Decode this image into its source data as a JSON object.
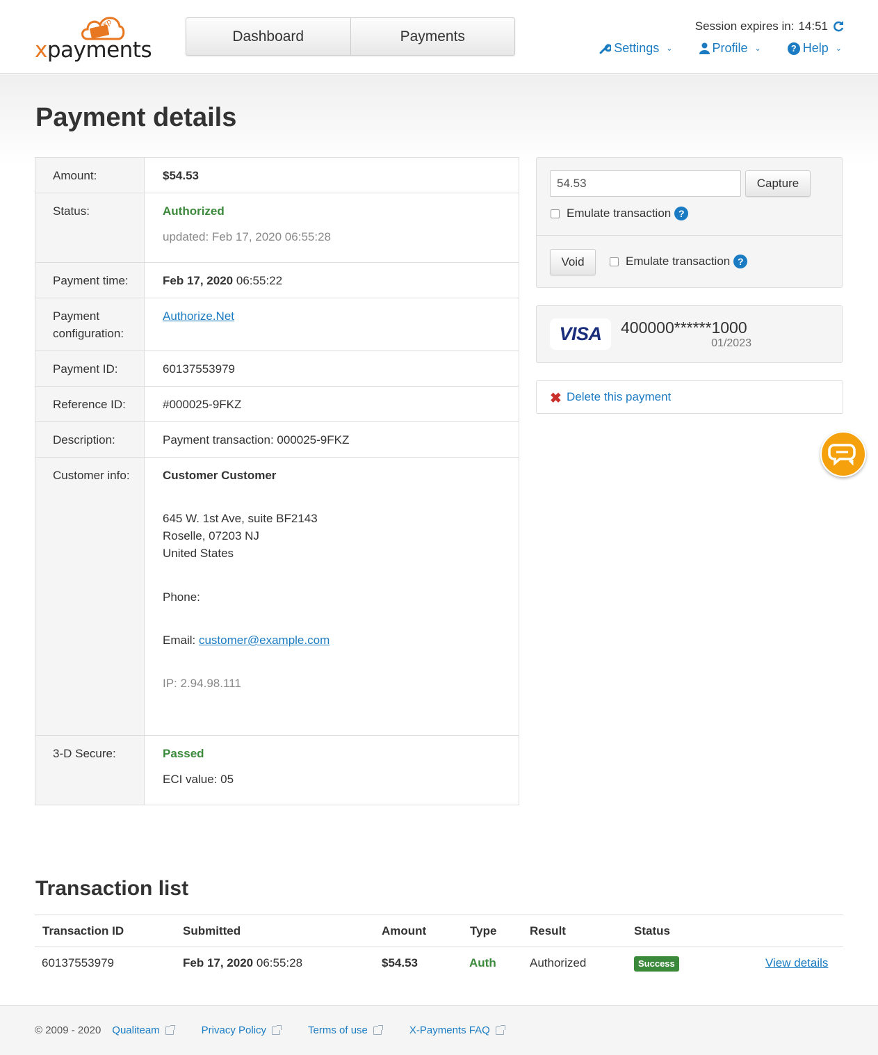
{
  "header": {
    "logo_text": "xpayments",
    "nav": [
      "Dashboard",
      "Payments"
    ],
    "session_label": "Session expires in:",
    "session_time": "14:51",
    "menu": {
      "settings": "Settings",
      "profile": "Profile",
      "help": "Help"
    }
  },
  "page_title": "Payment details",
  "details": {
    "amount_label": "Amount:",
    "amount": "$54.53",
    "status_label": "Status:",
    "status": "Authorized",
    "status_updated": "updated: Feb 17, 2020 06:55:28",
    "payment_time_label": "Payment time:",
    "payment_date": "Feb 17, 2020",
    "payment_clock": "06:55:22",
    "config_label": "Payment configuration:",
    "config": "Authorize.Net",
    "payment_id_label": "Payment ID:",
    "payment_id": "60137553979",
    "reference_label": "Reference ID:",
    "reference": "#000025-9FKZ",
    "description_label": "Description:",
    "description": "Payment transaction: 000025-9FKZ",
    "customer_label": "Customer info:",
    "customer_name": "Customer Customer",
    "address1": "645 W. 1st Ave, suite BF2143",
    "address2": "Roselle, 07203 NJ",
    "address3": "United States",
    "phone_label": "Phone:",
    "email_label": "Email:",
    "email": "customer@example.com",
    "ip": "IP: 2.94.98.111",
    "secure_label": "3-D Secure:",
    "secure_status": "Passed",
    "eci": "ECI value: 05"
  },
  "actions": {
    "capture_amount": "54.53",
    "capture_button": "Capture",
    "emulate_label": "Emulate transaction",
    "void_button": "Void",
    "emulate_label_2": "Emulate transaction"
  },
  "card": {
    "brand": "VISA",
    "number": "400000******1000",
    "expiry": "01/2023"
  },
  "delete_link": "Delete this payment",
  "transactions": {
    "title": "Transaction list",
    "headers": [
      "Transaction ID",
      "Submitted",
      "Amount",
      "Type",
      "Result",
      "Status"
    ],
    "rows": [
      {
        "id": "60137553979",
        "date": "Feb 17, 2020",
        "time": "06:55:28",
        "amount": "$54.53",
        "type": "Auth",
        "result": "Authorized",
        "status": "Success",
        "link": "View details"
      }
    ]
  },
  "footer": {
    "copyright": "© 2009 - 2020",
    "links": [
      "Qualiteam",
      "Privacy Policy",
      "Terms of use",
      "X-Payments FAQ"
    ]
  },
  "colors": {
    "accent": "#1a7bc2",
    "brand_orange": "#e87722",
    "success_green": "#3b8a3b",
    "danger_red": "#c9302c",
    "chat_orange": "#f5a00d"
  }
}
